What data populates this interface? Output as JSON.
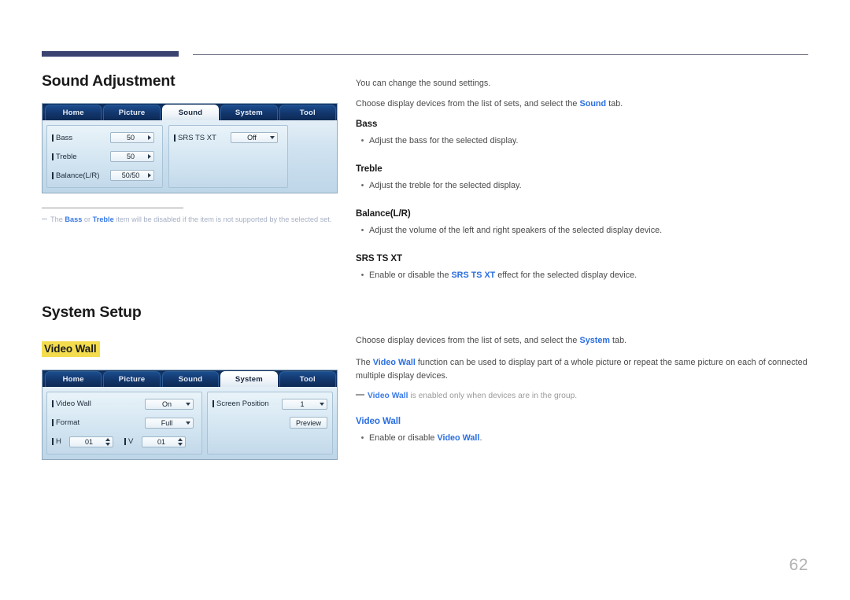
{
  "page": {
    "number": "62"
  },
  "header": {
    "rule_color": "#3b4371"
  },
  "left": {
    "section1_title": "Sound Adjustment",
    "section2_title": "System Setup",
    "highlight_label": "Video Wall",
    "footnote": {
      "prefix": "The ",
      "term1": "Bass",
      "middle": " or ",
      "term2": "Treble",
      "suffix": " item will be disabled if the item is not supported by the selected set."
    }
  },
  "osd_sound": {
    "tabs": [
      {
        "label": "Home",
        "active": false
      },
      {
        "label": "Picture",
        "active": false
      },
      {
        "label": "Sound",
        "active": true
      },
      {
        "label": "System",
        "active": false
      },
      {
        "label": "Tool",
        "active": false
      }
    ],
    "left_rows": [
      {
        "label": "Bass",
        "value": "50",
        "control": "arrow-right"
      },
      {
        "label": "Treble",
        "value": "50",
        "control": "arrow-right"
      },
      {
        "label": "Balance(L/R)",
        "value": "50/50",
        "control": "arrow-right"
      }
    ],
    "right_rows": [
      {
        "label": "SRS TS XT",
        "value": "Off",
        "control": "dropdown"
      }
    ]
  },
  "osd_system": {
    "tabs": [
      {
        "label": "Home",
        "active": false
      },
      {
        "label": "Picture",
        "active": false
      },
      {
        "label": "Sound",
        "active": false
      },
      {
        "label": "System",
        "active": true
      },
      {
        "label": "Tool",
        "active": false
      }
    ],
    "left_rows": [
      {
        "label": "Video Wall",
        "value": "On",
        "control": "dropdown"
      },
      {
        "label": "Format",
        "value": "Full",
        "control": "dropdown"
      }
    ],
    "hv": {
      "h_label": "H",
      "h_value": "01",
      "v_label": "V",
      "v_value": "01"
    },
    "right_rows": [
      {
        "label": "Screen Position",
        "value": "1",
        "control": "dropdown"
      }
    ],
    "preview_button": "Preview"
  },
  "right": {
    "intro1": "You can change the sound settings.",
    "choose_sound": {
      "before": "Choose display devices from the list of sets, and select the ",
      "term": "Sound",
      "after": " tab."
    },
    "sound_items": [
      {
        "heading": "Bass",
        "bullet": "Adjust the bass for the selected display."
      },
      {
        "heading": "Treble",
        "bullet": "Adjust the treble for the selected display."
      },
      {
        "heading": "Balance(L/R)",
        "bullet": "Adjust the volume of the left and right speakers of the selected display device."
      }
    ],
    "srs": {
      "heading": "SRS TS XT",
      "bullet_before": "Enable or disable the ",
      "bullet_term": "SRS TS XT",
      "bullet_after": " effect for the selected display device."
    },
    "choose_system": {
      "before": "Choose display devices from the list of sets, and select the ",
      "term": "System",
      "after": " tab."
    },
    "videowall_desc": {
      "before": "The ",
      "term": "Video Wall",
      "after": " function can be used to display part of a whole picture or repeat the same picture on each of connected multiple display devices."
    },
    "videowall_note": {
      "term": "Video Wall",
      "after": " is enabled only when devices are in the group."
    },
    "videowall_section": {
      "heading": "Video Wall",
      "bullet_before": "Enable or disable ",
      "bullet_term": "Video Wall",
      "bullet_after": "."
    }
  }
}
